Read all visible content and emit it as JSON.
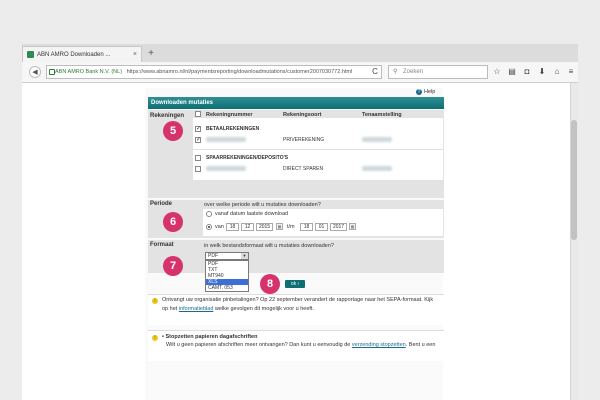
{
  "browser": {
    "tab_title": "ABN AMRO Downloaden ...",
    "tab_close": "×",
    "new_tab": "+",
    "identity": "ABN AMRO Bank N.V. (NL)",
    "url": "https://www.abnamro.nl/nl/paymentsreporting/downloadmutations/customer2007030772.html",
    "search_placeholder": "Zoeken",
    "reload": "C"
  },
  "header": {
    "help_label": "Help",
    "help_icon": "?",
    "title": "Downloaden mutaties"
  },
  "accounts": {
    "section_label": "Rekeningen",
    "columns": [
      "Rekeningnummer",
      "Rekeningsoort",
      "Tenaamstelling"
    ],
    "group_payment": "BETAALREKENINGEN",
    "group_savings": "SPAARREKENINGEN/DEPOSITO'S",
    "rows": [
      {
        "type": "PRIVEREKENING",
        "checked": true
      },
      {
        "type": "DIRECT SPAREN",
        "checked": false
      }
    ],
    "check_mark": "✓"
  },
  "period": {
    "section_label": "Periode",
    "question": "over welke periode wilt u mutaties downloaden?",
    "option_last": "vanaf datum laatste download",
    "option_range": "van",
    "from": {
      "day": "18",
      "month": "12",
      "year": "2015"
    },
    "to_label": "t/m",
    "to": {
      "day": "18",
      "month": "01",
      "year": "2017"
    },
    "selected": "range"
  },
  "format": {
    "section_label": "Formaat",
    "question": "in welk bestandsformaat wilt u mutaties downloaden?",
    "selected_value": "PDF",
    "options": [
      "PDF",
      "TXT",
      "MT940",
      "XLS",
      "CAMT. 053"
    ],
    "highlighted": "XLS"
  },
  "badges": [
    "5",
    "6",
    "7",
    "8"
  ],
  "ok_button": "ok ›",
  "notices": [
    {
      "text_before": "Ontvangt uw organisatie pinbetalingen? Op 22 september verandert de rapportage naar het SEPA-formaat. Kijk op het ",
      "link": "informatieblad",
      "text_after": " welke gevolgen dit mogelijk voor u heeft."
    },
    {
      "title": "Stopzetten papieren dagafschriften",
      "text_before": "Wilt u geen papieren afschriften meer ontvangen? Dan kunt u eenvoudig de ",
      "link": "verzending stopzetten",
      "text_after": ". Bent u een"
    }
  ],
  "icons": [
    "back-arrow-icon",
    "lock-icon",
    "reload-icon",
    "search-icon",
    "star-icon",
    "reader-icon",
    "pocket-icon",
    "download-icon",
    "home-icon",
    "menu-icon",
    "help-icon",
    "calendar-icon",
    "info-icon"
  ],
  "colors": {
    "accent": "#0d6e74",
    "badge": "#d6336c",
    "link": "#1a6a8e",
    "selection": "#3d6fd6"
  }
}
